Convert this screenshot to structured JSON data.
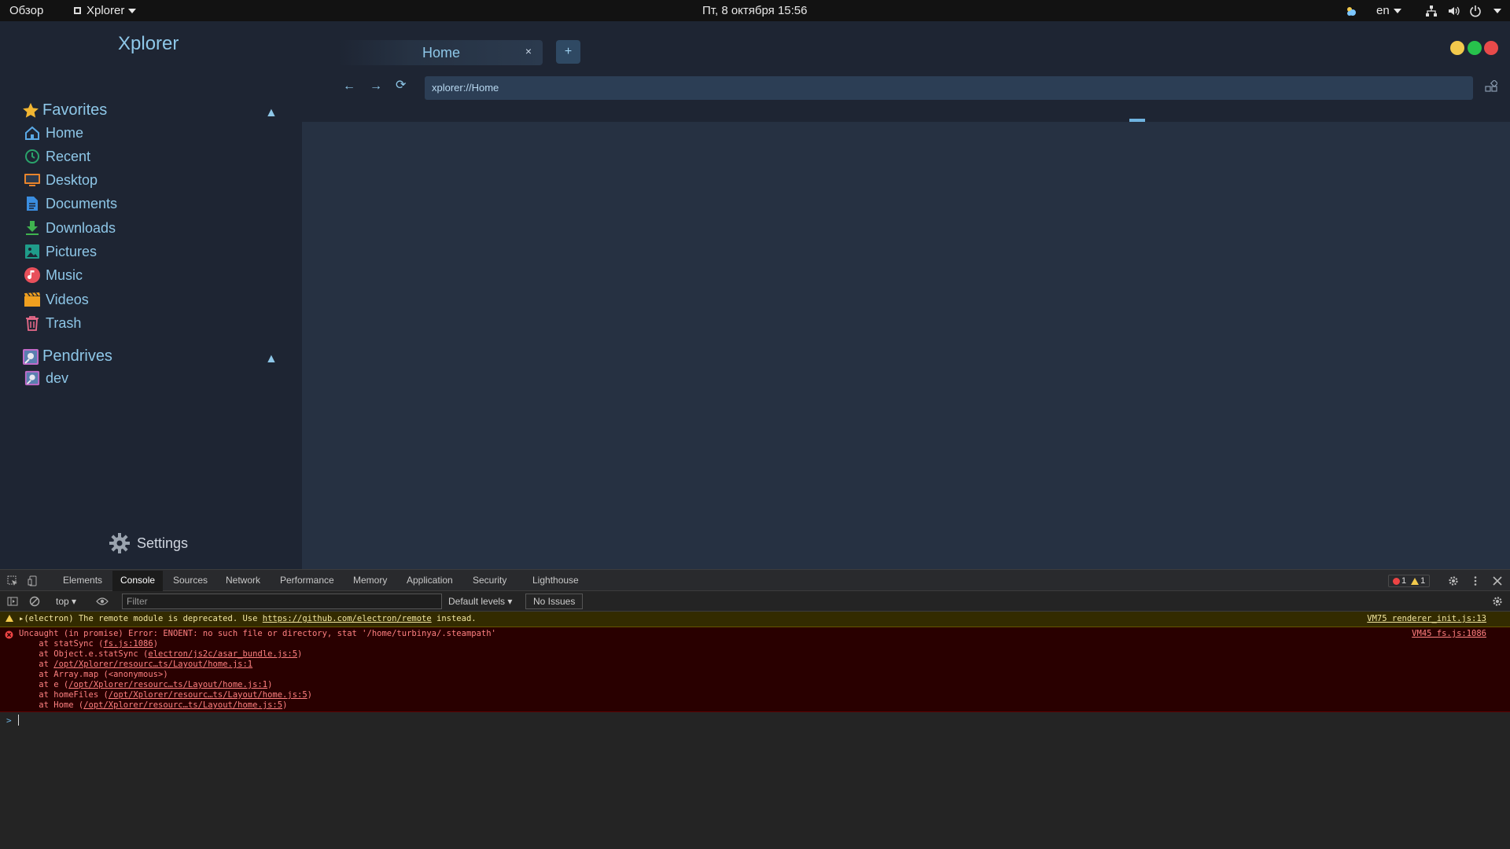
{
  "topbar": {
    "activities": "Обзор",
    "app_menu": "Xplorer",
    "clock": "Пт, 8 октября  15:56",
    "keyboard_layout": "en"
  },
  "app": {
    "title": "Xplorer",
    "favorites": {
      "heading": "Favorites",
      "toggle": "▲",
      "items": [
        {
          "label": "Home",
          "icon": "home-icon",
          "color": "#5aa9e6"
        },
        {
          "label": "Recent",
          "icon": "recent-icon",
          "color": "#2aa36b"
        },
        {
          "label": "Desktop",
          "icon": "desktop-icon",
          "color": "#e8842c"
        },
        {
          "label": "Documents",
          "icon": "documents-icon",
          "color": "#3a8de0"
        },
        {
          "label": "Downloads",
          "icon": "downloads-icon",
          "color": "#3fb34f"
        },
        {
          "label": "Pictures",
          "icon": "pictures-icon",
          "color": "#1f9c8a"
        },
        {
          "label": "Music",
          "icon": "music-icon",
          "color": "#e8505b"
        },
        {
          "label": "Videos",
          "icon": "videos-icon",
          "color": "#f0a020"
        },
        {
          "label": "Trash",
          "icon": "trash-icon",
          "color": "#e86a8a"
        }
      ]
    },
    "pendrives": {
      "heading": "Pendrives",
      "toggle": "▲",
      "items": [
        {
          "label": "dev",
          "icon": "drive-icon"
        }
      ]
    },
    "settings_label": "Settings",
    "tab": {
      "label": "Home",
      "close": "×"
    },
    "new_tab": "+",
    "nav": {
      "back": "←",
      "forward": "→",
      "reload": "⟳"
    },
    "address": "xplorer://Home",
    "window_buttons": {
      "minimize": "#f2c94c",
      "maximize": "#27c24c",
      "close": "#e84a4a"
    }
  },
  "devtools": {
    "tabs": [
      "Elements",
      "Console",
      "Sources",
      "Network",
      "Performance",
      "Memory",
      "Application",
      "Security",
      "Lighthouse"
    ],
    "active_tab": "Console",
    "error_count": "1",
    "warning_count": "1",
    "context": "top",
    "filter_placeholder": "Filter",
    "levels": "Default levels",
    "issues": "No Issues",
    "warning": {
      "prefix": "▸(electron) The remote module is deprecated. Use ",
      "link": "https://github.com/electron/remote",
      "suffix": " instead.",
      "source": "VM75 renderer_init.js:13"
    },
    "error": {
      "message": "Uncaught (in promise) Error: ENOENT: no such file or directory, stat '/home/turbinya/.steampath'",
      "source": "VM45 fs.js:1086",
      "stack": [
        {
          "pre": "    at statSync (",
          "link": "fs.js:1086",
          "post": ")"
        },
        {
          "pre": "    at Object.e.statSync (",
          "link": "electron/js2c/asar_bundle.js:5",
          "post": ")"
        },
        {
          "pre": "    at ",
          "link": "/opt/Xplorer/resourc…ts/Layout/home.js:1",
          "post": ""
        },
        {
          "pre": "    at Array.map (<anonymous>)",
          "link": "",
          "post": ""
        },
        {
          "pre": "    at e (",
          "link": "/opt/Xplorer/resourc…ts/Layout/home.js:1",
          "post": ")"
        },
        {
          "pre": "    at homeFiles (",
          "link": "/opt/Xplorer/resourc…ts/Layout/home.js:5",
          "post": ")"
        },
        {
          "pre": "    at Home (",
          "link": "/opt/Xplorer/resourc…ts/Layout/home.js:5",
          "post": ")"
        }
      ]
    },
    "prompt": ">"
  }
}
